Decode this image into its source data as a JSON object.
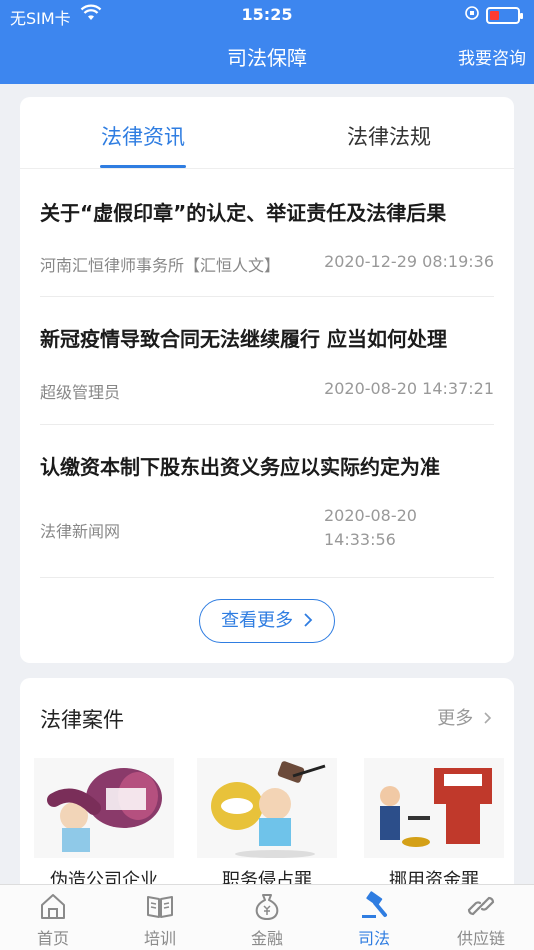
{
  "status": {
    "carrier": "无SIM卡",
    "time": "15:25"
  },
  "nav": {
    "title": "司法保障",
    "action": "我要咨询"
  },
  "tabs": [
    {
      "label": "法律资讯"
    },
    {
      "label": "法律法规"
    }
  ],
  "news": [
    {
      "title": "关于“虚假印章”的认定、举证责任及法律后果",
      "source": "河南汇恒律师事务所【汇恒人文】",
      "time": "2020-12-29 08:19:36"
    },
    {
      "title": "新冠疫情导致合同无法继续履行 应当如何处理",
      "source": "超级管理员",
      "time": "2020-08-20 14:37:21"
    },
    {
      "title": "认缴资本制下股东出资义务应以实际约定为准",
      "source": "法律新闻网",
      "time_line1": "2020-08-20",
      "time_line2": "14:33:56"
    }
  ],
  "more_button": "查看更多",
  "cases": {
    "title": "法律案件",
    "more": "更多",
    "items": [
      {
        "label": "伪造公司企业"
      },
      {
        "label": "职务侵占罪"
      },
      {
        "label": "挪用资金罪"
      }
    ]
  },
  "tabbar": [
    {
      "label": "首页",
      "icon": "home-icon"
    },
    {
      "label": "培训",
      "icon": "book-icon"
    },
    {
      "label": "金融",
      "icon": "money-bag-icon"
    },
    {
      "label": "司法",
      "icon": "gavel-icon"
    },
    {
      "label": "供应链",
      "icon": "link-icon"
    }
  ],
  "colors": {
    "primary": "#3d86ef",
    "accent": "#2f7de1"
  }
}
